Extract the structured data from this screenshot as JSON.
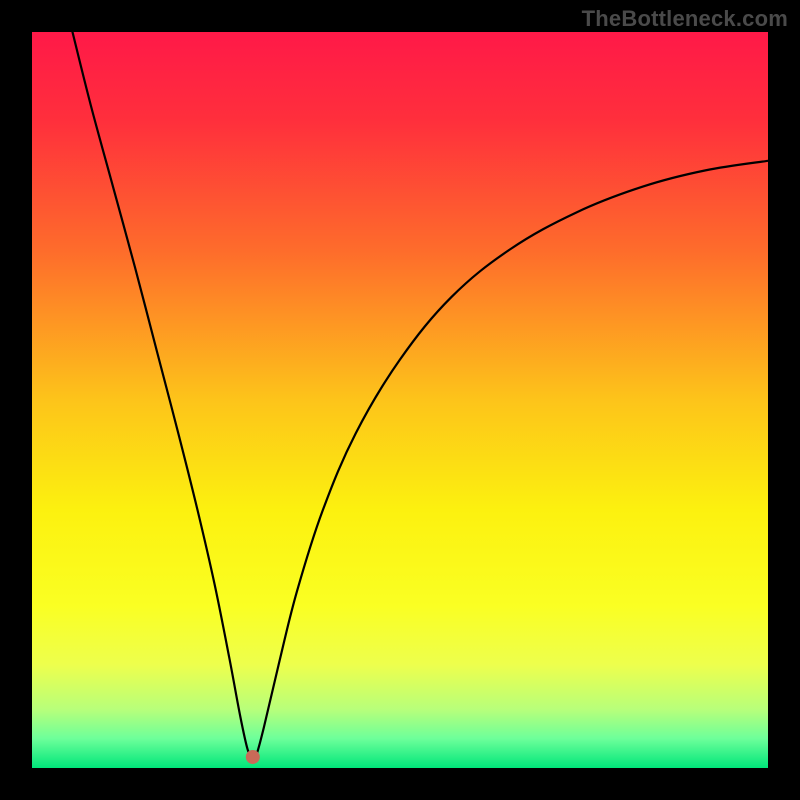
{
  "watermark": "TheBottleneck.com",
  "chart_data": {
    "type": "line",
    "title": "",
    "xlabel": "",
    "ylabel": "",
    "xlim": [
      0,
      1
    ],
    "ylim": [
      0,
      1
    ],
    "trough_x": 0.3,
    "marker": {
      "x": 0.3,
      "y": 0.015,
      "color": "#c96a58",
      "radius": 7
    },
    "gradient_stops": [
      {
        "offset": 0.0,
        "color": "#ff1948"
      },
      {
        "offset": 0.12,
        "color": "#ff2f3c"
      },
      {
        "offset": 0.3,
        "color": "#fe6d2b"
      },
      {
        "offset": 0.5,
        "color": "#fdc41a"
      },
      {
        "offset": 0.65,
        "color": "#fcf10f"
      },
      {
        "offset": 0.78,
        "color": "#faff23"
      },
      {
        "offset": 0.86,
        "color": "#edff4d"
      },
      {
        "offset": 0.92,
        "color": "#b8ff7a"
      },
      {
        "offset": 0.96,
        "color": "#6dff9a"
      },
      {
        "offset": 1.0,
        "color": "#00e67a"
      }
    ],
    "left_branch": [
      {
        "x": 0.055,
        "y": 1.0
      },
      {
        "x": 0.08,
        "y": 0.9
      },
      {
        "x": 0.11,
        "y": 0.79
      },
      {
        "x": 0.14,
        "y": 0.68
      },
      {
        "x": 0.17,
        "y": 0.565
      },
      {
        "x": 0.2,
        "y": 0.45
      },
      {
        "x": 0.225,
        "y": 0.35
      },
      {
        "x": 0.248,
        "y": 0.25
      },
      {
        "x": 0.268,
        "y": 0.15
      },
      {
        "x": 0.283,
        "y": 0.07
      },
      {
        "x": 0.293,
        "y": 0.025
      },
      {
        "x": 0.3,
        "y": 0.012
      }
    ],
    "right_branch": [
      {
        "x": 0.3,
        "y": 0.012
      },
      {
        "x": 0.305,
        "y": 0.018
      },
      {
        "x": 0.315,
        "y": 0.055
      },
      {
        "x": 0.335,
        "y": 0.14
      },
      {
        "x": 0.36,
        "y": 0.24
      },
      {
        "x": 0.395,
        "y": 0.35
      },
      {
        "x": 0.44,
        "y": 0.455
      },
      {
        "x": 0.5,
        "y": 0.555
      },
      {
        "x": 0.57,
        "y": 0.64
      },
      {
        "x": 0.65,
        "y": 0.705
      },
      {
        "x": 0.74,
        "y": 0.755
      },
      {
        "x": 0.83,
        "y": 0.79
      },
      {
        "x": 0.915,
        "y": 0.812
      },
      {
        "x": 1.0,
        "y": 0.825
      }
    ]
  }
}
